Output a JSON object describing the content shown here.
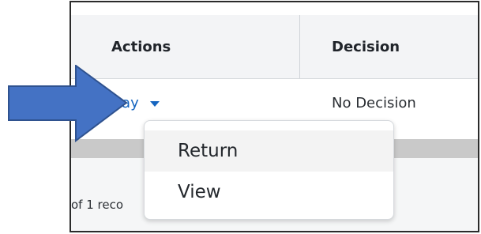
{
  "table": {
    "headers": {
      "actions": "Actions",
      "decision": "Decision"
    },
    "row": {
      "action_label": "Pay",
      "decision_value": "No Decision"
    },
    "footer_text": "of 1 reco"
  },
  "menu": {
    "items": [
      {
        "label": "Return"
      },
      {
        "label": "View"
      }
    ]
  },
  "colors": {
    "link": "#1565c0",
    "arrow_fill": "#4472c4",
    "arrow_stroke": "#2f528f"
  },
  "icons": {
    "caret": "chevron-down-icon",
    "pointer": "arrow-right-icon"
  }
}
